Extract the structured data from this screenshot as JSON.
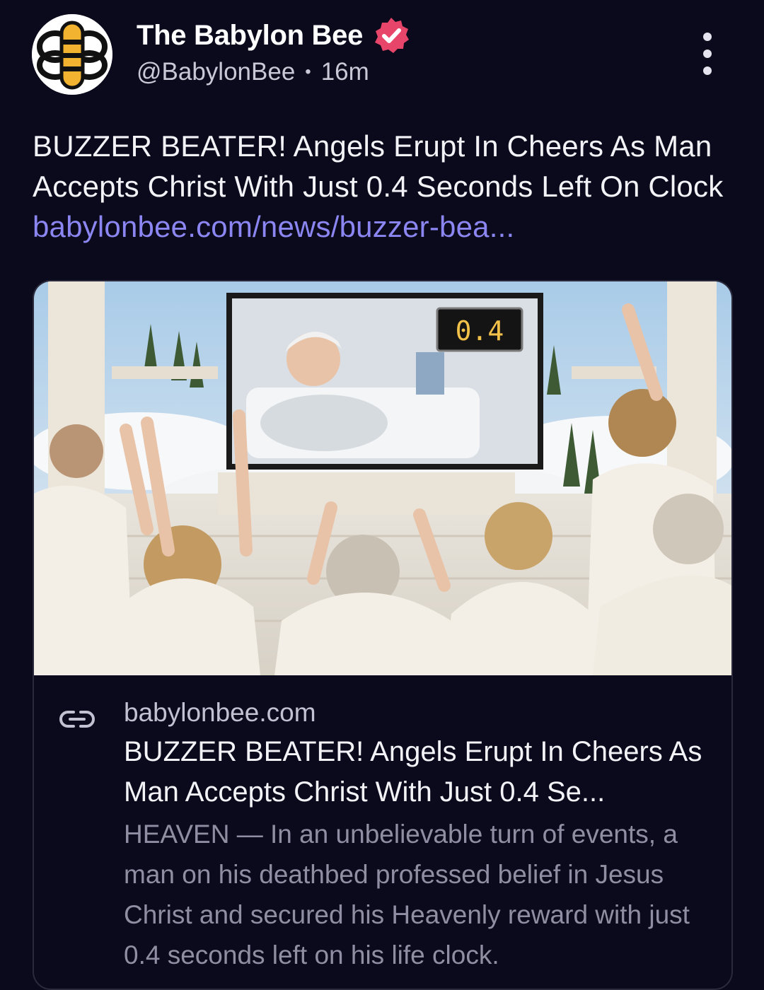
{
  "account": {
    "display_name": "The Babylon Bee",
    "handle": "@BabylonBee",
    "separator": "•",
    "time_ago": "16m",
    "verified_icon": "verified-badge-icon",
    "avatar_icon": "bee-logo-icon",
    "verified_color": "#e8456a"
  },
  "post": {
    "text": "BUZZER BEATER! Angels Erupt In Cheers As Man Accepts Christ With Just 0.4 Seconds Left On Clock",
    "link_text": "babylonbee.com/news/buzzer-bea...",
    "link_color": "#8b86f2"
  },
  "card": {
    "scoreboard_value": "0.4",
    "link_icon": "link-icon",
    "domain": "babylonbee.com",
    "title": "BUZZER BEATER! Angels Erupt In Cheers As Man Accepts Christ With Just 0.4 Se...",
    "description": "HEAVEN — In an unbelievable turn of events, a man on his deathbed professed belief in Jesus Christ and secured his Heavenly reward with just 0.4 seconds left on his life clock."
  },
  "menu": {
    "icon": "more-options-icon"
  }
}
